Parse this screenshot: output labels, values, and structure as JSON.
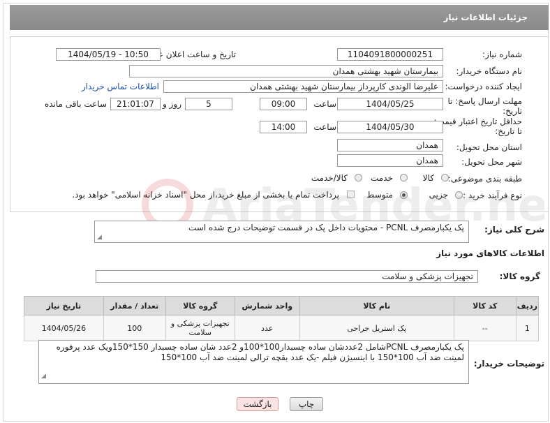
{
  "header": {
    "title": "جزئیات اطلاعات نیاز"
  },
  "form": {
    "need_number_label": "شماره نیاز:",
    "need_number": "1104091800000251",
    "announce_label": "تاریخ و ساعت اعلان عمومی:",
    "announce_value": "1404/05/19 - 10:50",
    "buyer_label": "نام دستگاه خریدار:",
    "buyer": "بیمارستان شهید بهشتی همدان",
    "requester_label": "ایجاد کننده درخواست:",
    "requester": "علیرضا الوندی کارپرداز بیمارستان شهید بهشتی همدان",
    "contact_link": "اطلاعات تماس خریدار",
    "deadline_label": "مهلت ارسال پاسخ: تا تاریخ:",
    "deadline_date": "1404/05/25",
    "deadline_time_label": "ساعت",
    "deadline_time": "09:00",
    "days": "5",
    "days_label": "روز و",
    "remaining_time": "21:01:07",
    "remaining_label": "ساعت باقی مانده",
    "validity_label": "حداقل تاریخ اعتبار قیمت: تا تاریخ:",
    "validity_date": "1404/05/30",
    "validity_time_label": "ساعت",
    "validity_time": "14:00",
    "province_label": "استان محل تحویل:",
    "province": "همدان",
    "city_label": "شهر محل تحویل:",
    "city": "همدان",
    "category_label": "طبقه بندی موضوعی:",
    "category_options": [
      "کالا",
      "خدمت",
      "کالا/خدمت"
    ],
    "process_label": "نوع فرآیند خرید :",
    "process_options": [
      "جزیی",
      "متوسط"
    ],
    "payment_note": "پرداخت تمام یا بخشی از مبلغ خرید،از محل \"اسناد خزانه اسلامی\" خواهد بود."
  },
  "description": {
    "label": "شرح کلی نیاز:",
    "text": "پک یکبارمصرف PCNL  - محتویات داخل پک در قسمت توضیحات درج شده است"
  },
  "goods": {
    "section_title": "اطلاعات کالاهای مورد نیاز",
    "group_label": "گروه کالا:",
    "group_value": "تجهیزات پزشکی و سلامت",
    "columns": [
      "ردیف",
      "کد کالا",
      "نام کالا",
      "واحد شمارش",
      "گروه کالا",
      "تعداد / مقدار",
      "تاریخ نیاز"
    ],
    "rows": [
      [
        "1",
        "--",
        "پک استریل جراحی",
        "عدد",
        "تجهیزات پزشکی و سلامت",
        "100",
        "1404/05/26"
      ]
    ]
  },
  "buyer_notes": {
    "label": "توضیحات خریدار:",
    "text": "پک یکبارمصرف PCNLشامل 2عددشان ساده چسبدار100*100و 2عدد شان ساده چسبدار 150*150ویک عدد پرفوره لمینت ضد آب 100*150 با اینسیژن فیلم -یک عدد بقچه ترالی لمینت ضد آب 100*150"
  },
  "buttons": {
    "print": "چاپ",
    "back": "بازگشت"
  }
}
